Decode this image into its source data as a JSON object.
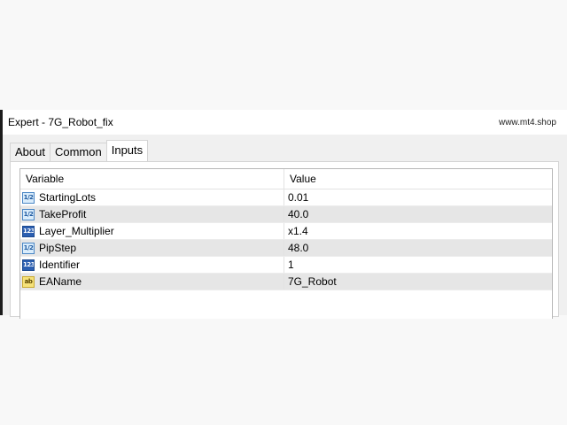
{
  "window": {
    "title": "Expert - 7G_Robot_fix",
    "watermark": "www.mt4.shop"
  },
  "tabs": [
    {
      "label": "About",
      "active": false
    },
    {
      "label": "Common",
      "active": false
    },
    {
      "label": "Inputs",
      "active": true
    }
  ],
  "table": {
    "columns": [
      "Variable",
      "Value"
    ],
    "rows": [
      {
        "icon": "double-type-icon",
        "icon_text": "1/2",
        "variable": "StartingLots",
        "value": "0.01"
      },
      {
        "icon": "double-type-icon",
        "icon_text": "1/2",
        "variable": "TakeProfit",
        "value": "40.0"
      },
      {
        "icon": "integer-type-icon",
        "icon_text": "123",
        "variable": "Layer_Multiplier",
        "value": "x1.4"
      },
      {
        "icon": "double-type-icon",
        "icon_text": "1/2",
        "variable": "PipStep",
        "value": "48.0"
      },
      {
        "icon": "integer-type-icon",
        "icon_text": "123",
        "variable": "Identifier",
        "value": "1"
      },
      {
        "icon": "string-type-icon",
        "icon_text": "ab",
        "variable": "EAName",
        "value": "7G_Robot"
      }
    ]
  },
  "colors": {
    "page_background": "#f8f8f8",
    "dialog_background": "#f0f0f0",
    "alt_row": "#e6e6e6",
    "double_icon": "#d9ecfb",
    "integer_icon": "#2c5fb1",
    "string_icon": "#f6e27a"
  }
}
